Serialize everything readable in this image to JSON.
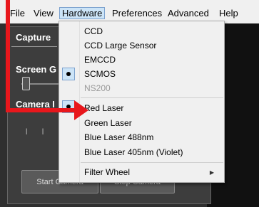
{
  "menubar": {
    "items": [
      "File",
      "View",
      "Hardware",
      "Preferences",
      "Advanced",
      "Help"
    ]
  },
  "panel": {
    "tab_label": "Capture",
    "screen_gain_label": "Screen G",
    "camera_label": "Camera I",
    "ticks": "| | | |",
    "start_button": "Start Camera",
    "stop_button": "Stop Camera"
  },
  "hardware_menu": {
    "items": [
      {
        "label": "CCD"
      },
      {
        "label": "CCD Large Sensor"
      },
      {
        "label": "EMCCD"
      },
      {
        "label": "SCMOS",
        "checked": true
      },
      {
        "label": "NS200",
        "disabled": true
      },
      {
        "label": "Red Laser",
        "checked": true
      },
      {
        "label": "Green Laser"
      },
      {
        "label": "Blue Laser 488nm"
      },
      {
        "label": "Blue Laser 405nm (Violet)"
      },
      {
        "label": "Filter Wheel",
        "submenu": true
      }
    ]
  },
  "colors": {
    "annotation_arrow": "#e8171c",
    "menu_highlight": "#cce4f7"
  }
}
